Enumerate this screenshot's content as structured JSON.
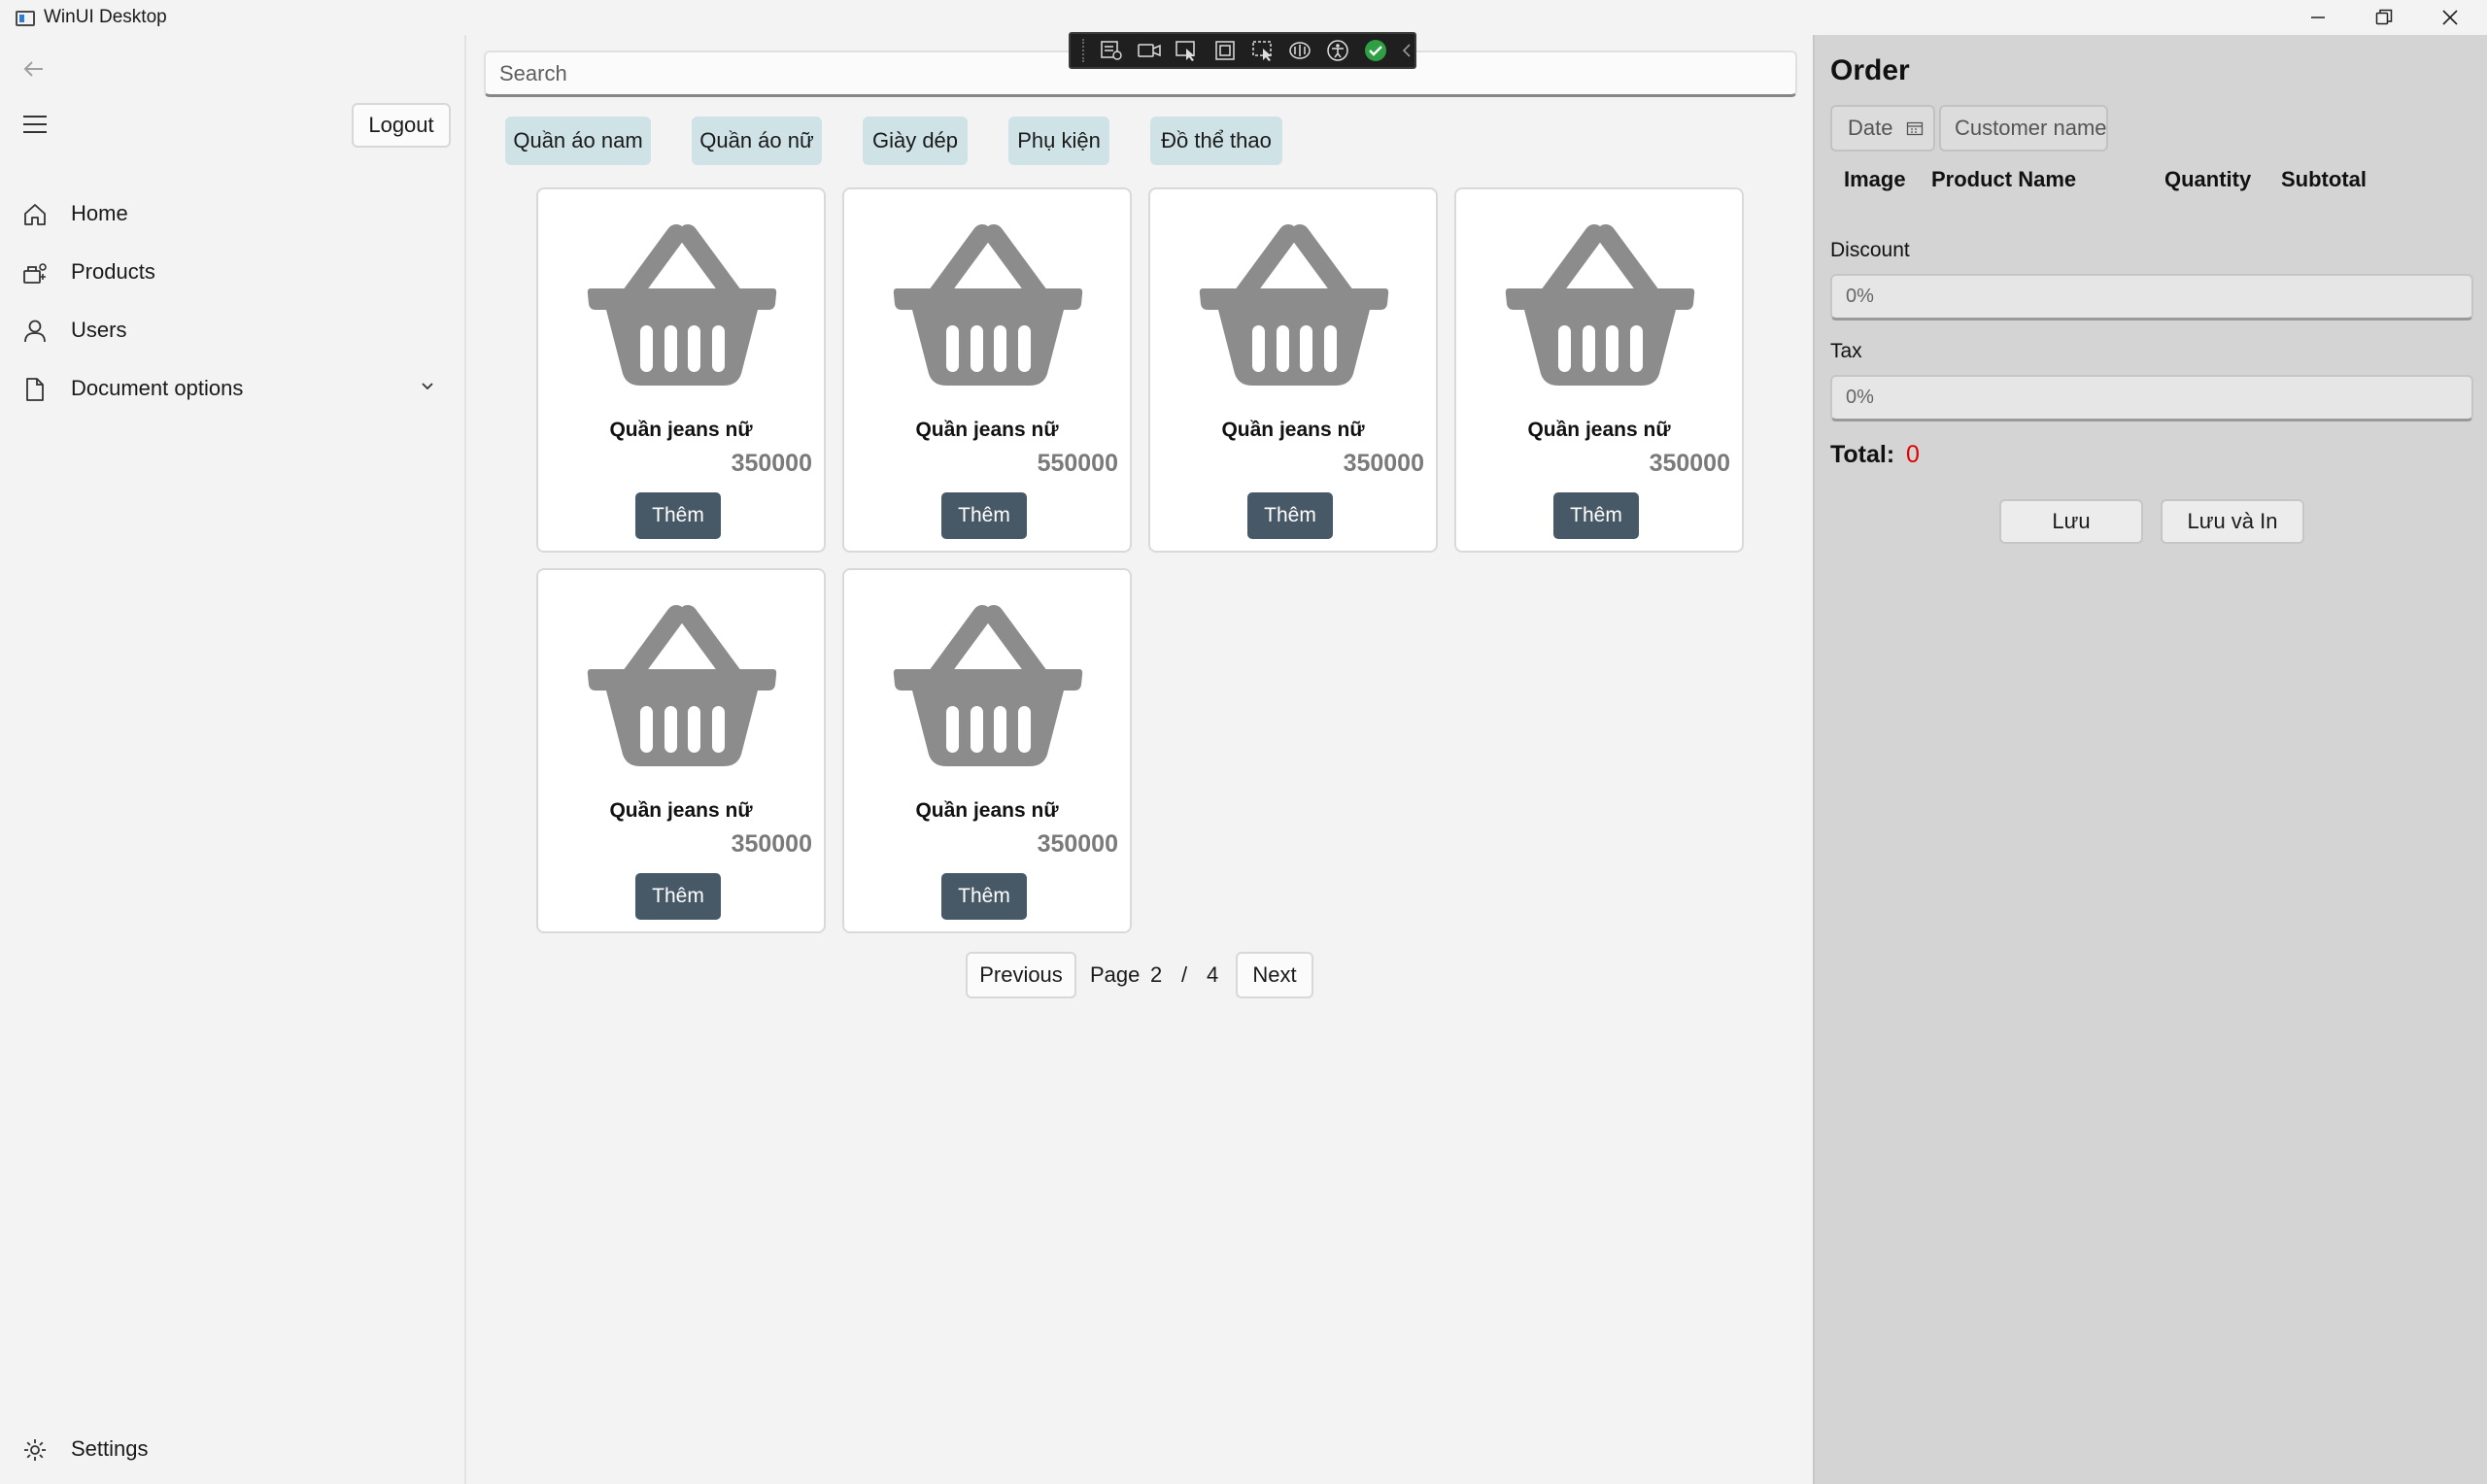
{
  "window": {
    "title": "WinUI Desktop"
  },
  "nav": {
    "logout_label": "Logout",
    "items": [
      {
        "label": "Home",
        "icon": "home-icon"
      },
      {
        "label": "Products",
        "icon": "products-icon"
      },
      {
        "label": "Users",
        "icon": "user-icon"
      },
      {
        "label": "Document options",
        "icon": "document-icon"
      }
    ],
    "settings_label": "Settings"
  },
  "main": {
    "search_placeholder": "Search",
    "categories": [
      "Quần áo nam",
      "Quần áo nữ",
      "Giày dép",
      "Phụ kiện",
      "Đồ thể thao"
    ],
    "products": [
      {
        "name": "Quần jeans nữ",
        "price": "350000",
        "button": "Thêm",
        "icon": "basket-icon"
      },
      {
        "name": "Quần jeans nữ",
        "price": "550000",
        "button": "Thêm",
        "icon": "basket-icon"
      },
      {
        "name": "Quần jeans nữ",
        "price": "350000",
        "button": "Thêm",
        "icon": "basket-icon"
      },
      {
        "name": "Quần jeans nữ",
        "price": "350000",
        "button": "Thêm",
        "icon": "basket-icon"
      },
      {
        "name": "Quần jeans nữ",
        "price": "350000",
        "button": "Thêm",
        "icon": "basket-icon"
      },
      {
        "name": "Quần jeans nữ",
        "price": "350000",
        "button": "Thêm",
        "icon": "basket-icon"
      }
    ],
    "pager": {
      "previous_label": "Previous",
      "page_label": "Page",
      "current": "2",
      "separator": "/",
      "total": "4",
      "next_label": "Next"
    }
  },
  "order": {
    "title": "Order",
    "date_placeholder": "Date",
    "customer_placeholder": "Customer name",
    "columns": [
      "Image",
      "Product Name",
      "Quantity",
      "Subtotal"
    ],
    "discount_label": "Discount",
    "discount_value": "0%",
    "tax_label": "Tax",
    "tax_value": "0%",
    "total_label": "Total:",
    "total_value": "0",
    "save_label": "Lưu",
    "save_print_label": "Lưu và In"
  },
  "colors": {
    "accent_button": "#475866",
    "category_chip": "#cfe2e6",
    "total_value": "#e00000",
    "order_panel": "#d4d4d4"
  }
}
